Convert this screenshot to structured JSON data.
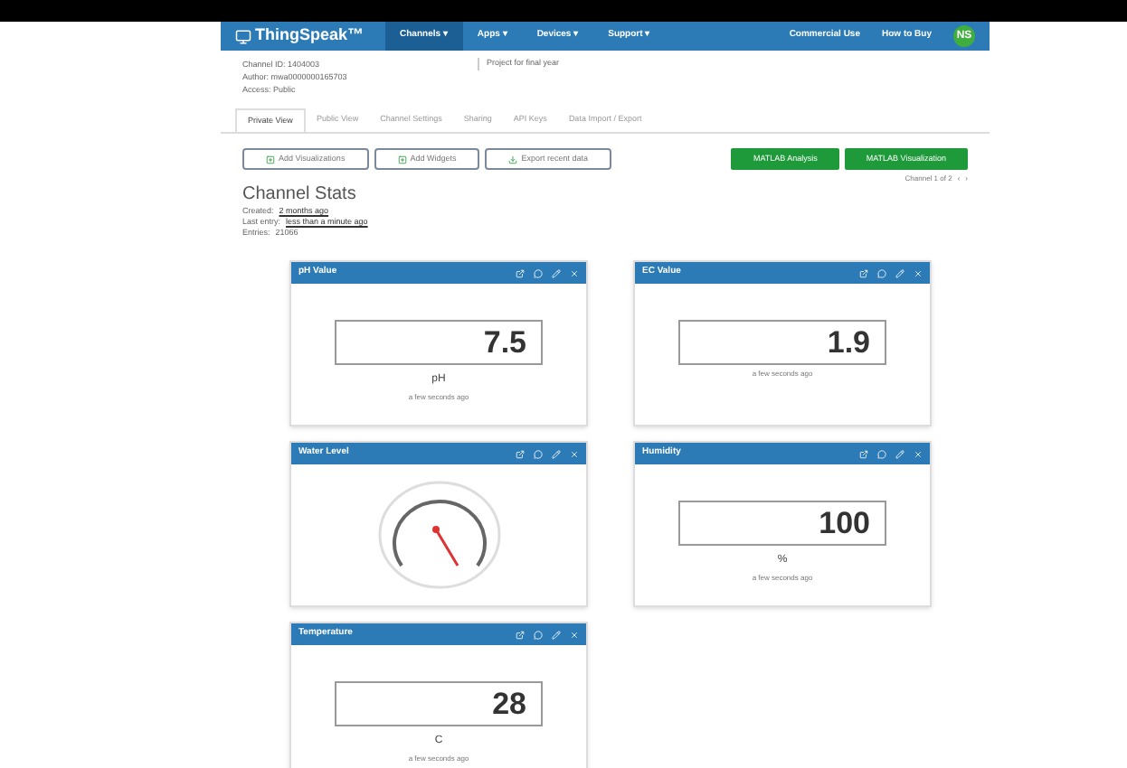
{
  "nav": {
    "brand": "ThingSpeak™",
    "items": [
      {
        "label": "Channels ▾",
        "selected": true
      },
      {
        "label": "Apps ▾",
        "selected": false
      },
      {
        "label": "Devices ▾",
        "selected": false
      },
      {
        "label": "Support ▾",
        "selected": false
      }
    ],
    "right_links": [
      "Commercial Use",
      "How to Buy"
    ],
    "avatar": "NS"
  },
  "channel_info": {
    "lines": [
      "Channel ID: 1404003",
      "Author: mwa0000000165703",
      "Access: Public"
    ],
    "description": "Project for final year"
  },
  "tabs": [
    {
      "label": "Private View",
      "selected": true
    },
    {
      "label": "Public View",
      "selected": false
    },
    {
      "label": "Channel Settings",
      "selected": false
    },
    {
      "label": "Sharing",
      "selected": false
    },
    {
      "label": "API Keys",
      "selected": false
    },
    {
      "label": "Data Import / Export",
      "selected": false
    }
  ],
  "actions": [
    "Add Visualizations",
    "Add Widgets",
    "Export recent data"
  ],
  "matlab_buttons": [
    "MATLAB Analysis",
    "MATLAB Visualization"
  ],
  "pager": {
    "label": "Channel 1 of 2",
    "prev": "‹",
    "next": "›"
  },
  "stats": {
    "title": "Channel Stats",
    "rows": [
      {
        "label": "Created:",
        "value": "2 months ago"
      },
      {
        "label": "Last entry:",
        "value": "less than a minute ago"
      },
      {
        "label": "Entries:",
        "value": "21066"
      }
    ]
  },
  "widgets": [
    {
      "kind": "numeric",
      "title": "pH Value",
      "value": "7.5",
      "unit": "pH",
      "updated": "a few seconds ago"
    },
    {
      "kind": "numeric",
      "title": "EC Value",
      "value": "1.9",
      "updated": "a few seconds ago"
    },
    {
      "kind": "gauge",
      "title": "Water Level"
    },
    {
      "kind": "numeric",
      "title": "Humidity",
      "value": "100",
      "unit": "%",
      "updated": "a few seconds ago"
    },
    {
      "kind": "numeric",
      "title": "Temperature",
      "value": "28",
      "unit": "C",
      "updated": "a few seconds ago"
    }
  ]
}
